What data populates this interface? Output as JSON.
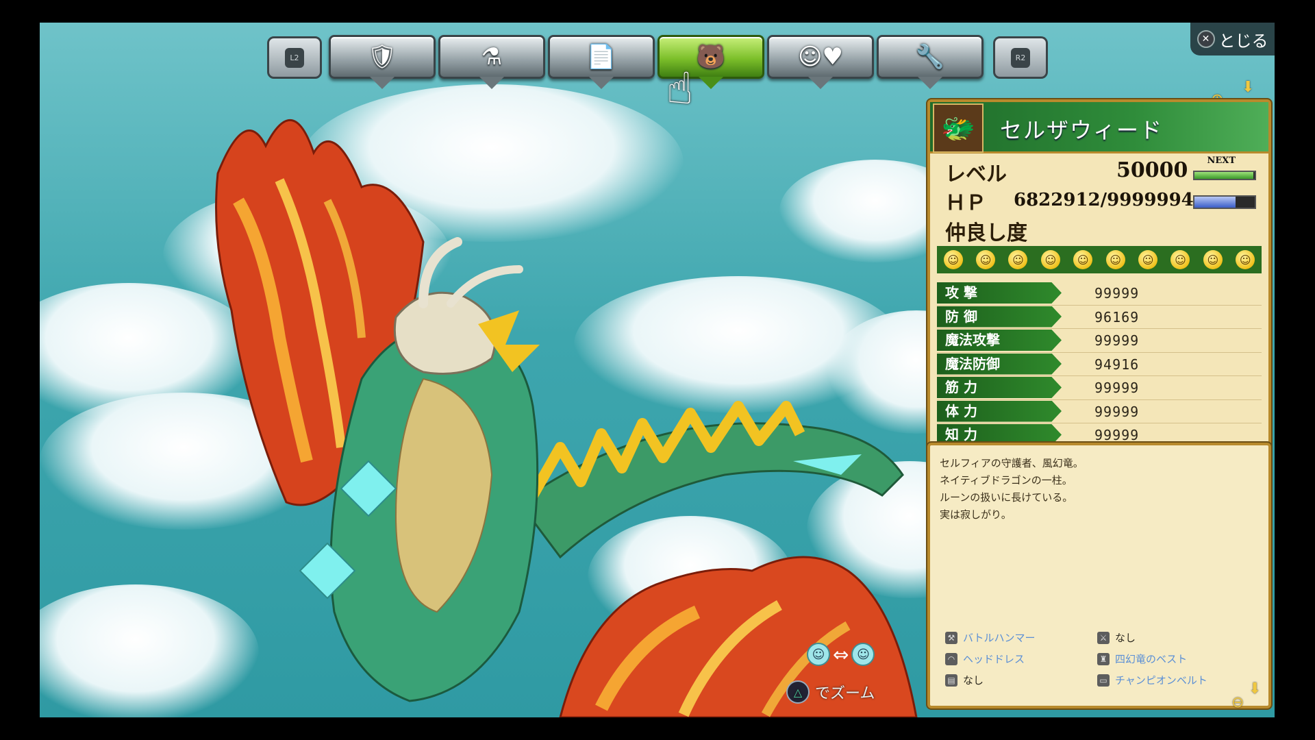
{
  "close": {
    "label": "とじる",
    "button_icon": "✕"
  },
  "menu": {
    "left_shoulder": "L2",
    "right_shoulder": "R2",
    "tabs": [
      {
        "name": "equipment",
        "icon": "sword-shield-icon",
        "glyph": "🛡"
      },
      {
        "name": "items",
        "icon": "flask-hammer-icon",
        "glyph": "⚗"
      },
      {
        "name": "notes",
        "icon": "document-icon",
        "glyph": "📄"
      },
      {
        "name": "party",
        "icon": "party-faces-icon",
        "glyph": "🐻",
        "active": true
      },
      {
        "name": "friendship",
        "icon": "smile-heart-icon",
        "glyph": "☺♥"
      },
      {
        "name": "settings",
        "icon": "wrench-icon",
        "glyph": "🔧"
      }
    ]
  },
  "character": {
    "name": "セルザウィード",
    "portrait_icon": "dragon-portrait-icon",
    "level_label": "レベル",
    "level": "50000",
    "next_label": "NEXT",
    "next_fill": 0.98,
    "hp_label": "ＨＰ",
    "hp": "6822912/9999994",
    "hp_fill": 0.68,
    "affinity_label": "仲良し度",
    "affinity_count": 10
  },
  "params": [
    {
      "label": "攻 撃",
      "value": "99999"
    },
    {
      "label": "防 御",
      "value": "96169"
    },
    {
      "label": "魔法攻撃",
      "value": "99999"
    },
    {
      "label": "魔法防御",
      "value": "94916"
    },
    {
      "label": "筋 力",
      "value": "99999"
    },
    {
      "label": "体 力",
      "value": "99999"
    },
    {
      "label": "知 力",
      "value": "99999"
    }
  ],
  "description": [
    "セルフィアの守護者、風幻竜。",
    "ネイティブドラゴンの一柱。",
    "ルーンの扱いに長けている。",
    "実は寂しがり。"
  ],
  "equipment": [
    {
      "label": "バトルハンマー",
      "style": "blue"
    },
    {
      "label": "なし",
      "style": "dark"
    },
    {
      "label": "ヘッドドレス",
      "style": "blue"
    },
    {
      "label": "四幻竜のベスト",
      "style": "blue"
    },
    {
      "label": "なし",
      "style": "dark"
    },
    {
      "label": "チャンピオンベルト",
      "style": "blue"
    }
  ],
  "zoom_prompt": "でズーム",
  "colors": {
    "panel_border": "#b88a2c",
    "active_tab": "#7cbf2a",
    "stat_green": "#2f8a2c"
  }
}
